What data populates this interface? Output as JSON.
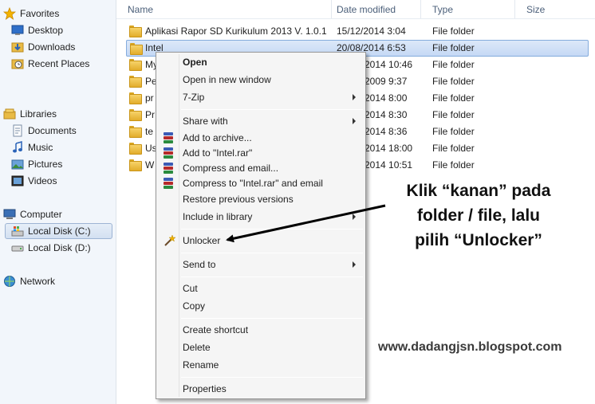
{
  "nav": {
    "favorites": "Favorites",
    "desktop": "Desktop",
    "downloads": "Downloads",
    "recent_places": "Recent Places",
    "libraries": "Libraries",
    "documents": "Documents",
    "music": "Music",
    "pictures": "Pictures",
    "videos": "Videos",
    "computer": "Computer",
    "local_c": "Local Disk (C:)",
    "local_d": "Local Disk (D:)",
    "network": "Network"
  },
  "columns": {
    "name": "Name",
    "date_modified": "Date modified",
    "type": "Type",
    "size": "Size"
  },
  "rows": [
    {
      "name": "Aplikasi Rapor SD Kurikulum 2013 V. 1.0.1",
      "date": "15/12/2014 3:04",
      "type": "File folder"
    },
    {
      "name": "Intel",
      "date": "20/08/2014 6:53",
      "type": "File folder"
    },
    {
      "name": "My",
      "date": "2014 10:46",
      "type": "File folder"
    },
    {
      "name": "Pe",
      "date": "2009 9:37",
      "type": "File folder"
    },
    {
      "name": "pr",
      "date": "2014 8:00",
      "type": "File folder"
    },
    {
      "name": "Pr",
      "date": "2014 8:30",
      "type": "File folder"
    },
    {
      "name": "te",
      "date": "2014 8:36",
      "type": "File folder"
    },
    {
      "name": "Us",
      "date": "2014 18:00",
      "type": "File folder"
    },
    {
      "name": "W",
      "date": "2014 10:51",
      "type": "File folder"
    }
  ],
  "menu": {
    "open": "Open",
    "open_new_window": "Open in new window",
    "seven_zip": "7-Zip",
    "share_with": "Share with",
    "add_to_archive": "Add to archive...",
    "add_to_intel_rar": "Add to \"Intel.rar\"",
    "compress_email": "Compress and email...",
    "compress_intel_email": "Compress to \"Intel.rar\" and email",
    "restore_previous": "Restore previous versions",
    "include_library": "Include in library",
    "unlocker": "Unlocker",
    "send_to": "Send to",
    "cut": "Cut",
    "copy": "Copy",
    "create_shortcut": "Create shortcut",
    "delete": "Delete",
    "rename": "Rename",
    "properties": "Properties"
  },
  "annotation": {
    "line1": "Klik “kanan” pada",
    "line2": "folder / file, lalu",
    "line3": "pilih “Unlocker”"
  },
  "watermark": "www.dadangjsn.blogspot.com",
  "colors": {
    "selection": "#c5d9f5",
    "selection_border": "#84acdd",
    "nav_bg": "#f2f6fb",
    "menu_bg": "#f5f5f5"
  }
}
